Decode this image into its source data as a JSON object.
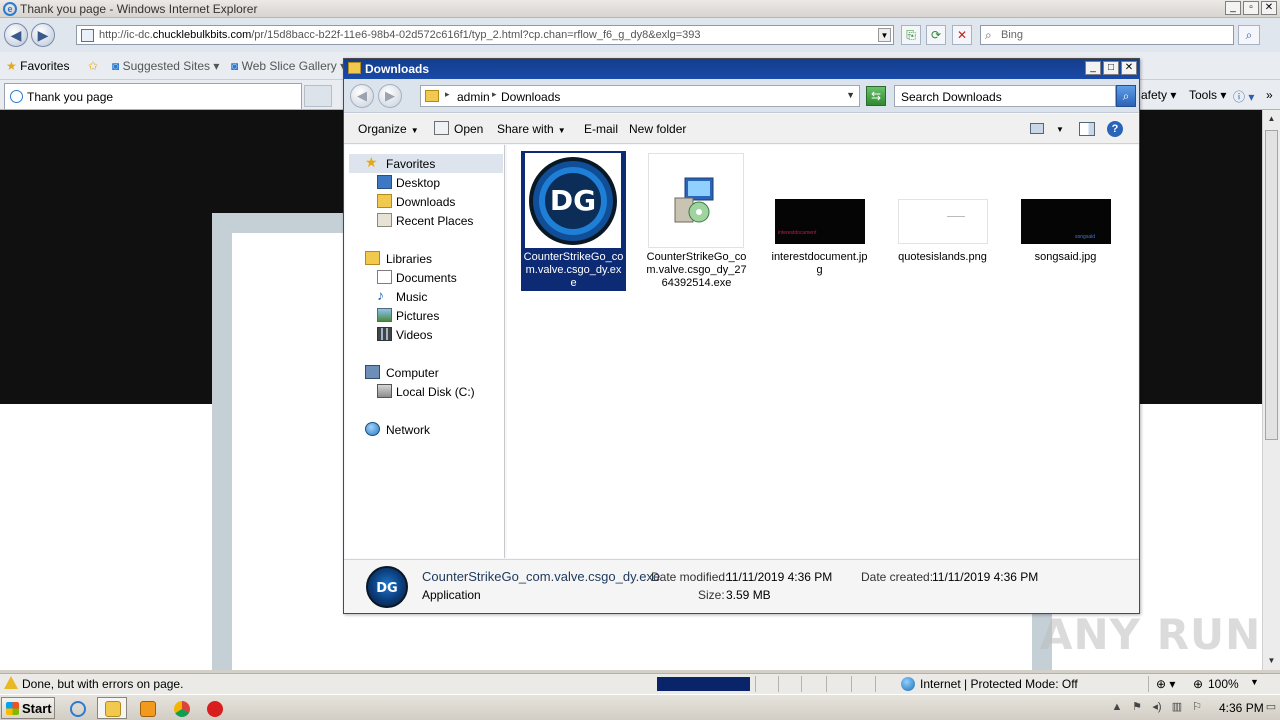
{
  "ie": {
    "window_title": "Thank you page - Windows Internet Explorer",
    "address_url_prefix": "http://ic-dc.",
    "address_url_domain": "chucklebulkbits.com",
    "address_url_path": "/pr/15d8bacc-b22f-11e6-98b4-02d572c616f1/typ_2.html?cp.chan=rflow_f6_g_dy8&exlg=393",
    "search_placeholder": "Bing",
    "favorites_label": "Favorites",
    "suggested_sites_label": "Suggested Sites",
    "web_slice_label": "Web Slice Gallery",
    "tab_title": "Thank you page",
    "safety_label": "afety",
    "tools_label": "Tools",
    "status_message": "Done, but with errors on page.",
    "zone_text": "Internet | Protected Mode: Off",
    "zoom_text": "100%"
  },
  "explorer": {
    "title": "Downloads",
    "breadcrumb": [
      "admin",
      "Downloads"
    ],
    "search_placeholder": "Search Downloads",
    "toolbar": {
      "organize": "Organize",
      "open": "Open",
      "share_with": "Share with",
      "email": "E-mail",
      "new_folder": "New folder"
    },
    "nav": {
      "favorites": "Favorites",
      "desktop": "Desktop",
      "downloads": "Downloads",
      "recent_places": "Recent Places",
      "libraries": "Libraries",
      "documents": "Documents",
      "music": "Music",
      "pictures": "Pictures",
      "videos": "Videos",
      "computer": "Computer",
      "local_disk": "Local Disk (C:)",
      "network": "Network"
    },
    "files": [
      {
        "name": "CounterStrikeGo_com.valve.csgo_dy.exe",
        "selected": true,
        "icon": "dg-logo-icon"
      },
      {
        "name": "CounterStrikeGo_com.valve.csgo_dy_2764392514.exe",
        "selected": false,
        "icon": "installer-icon"
      },
      {
        "name": "interestdocument.jpg",
        "selected": false,
        "icon": "image-thumbnail-black"
      },
      {
        "name": "quotesislands.png",
        "selected": false,
        "icon": "image-thumbnail-white"
      },
      {
        "name": "songsaid.jpg",
        "selected": false,
        "icon": "image-thumbnail-black"
      }
    ],
    "thumb_texts": {
      "interestdocument": "interestdocument",
      "songsaid": "songsaid"
    },
    "details": {
      "filename": "CounterStrikeGo_com.valve.csgo_dy.exe",
      "type": "Application",
      "date_modified_label": "Date modified:",
      "date_modified": "11/11/2019 4:36 PM",
      "size_label": "Size:",
      "size": "3.59 MB",
      "date_created_label": "Date created:",
      "date_created": "11/11/2019 4:36 PM"
    }
  },
  "taskbar": {
    "start_label": "Start",
    "clock": "4:36 PM"
  },
  "watermark": "ANY RUN"
}
